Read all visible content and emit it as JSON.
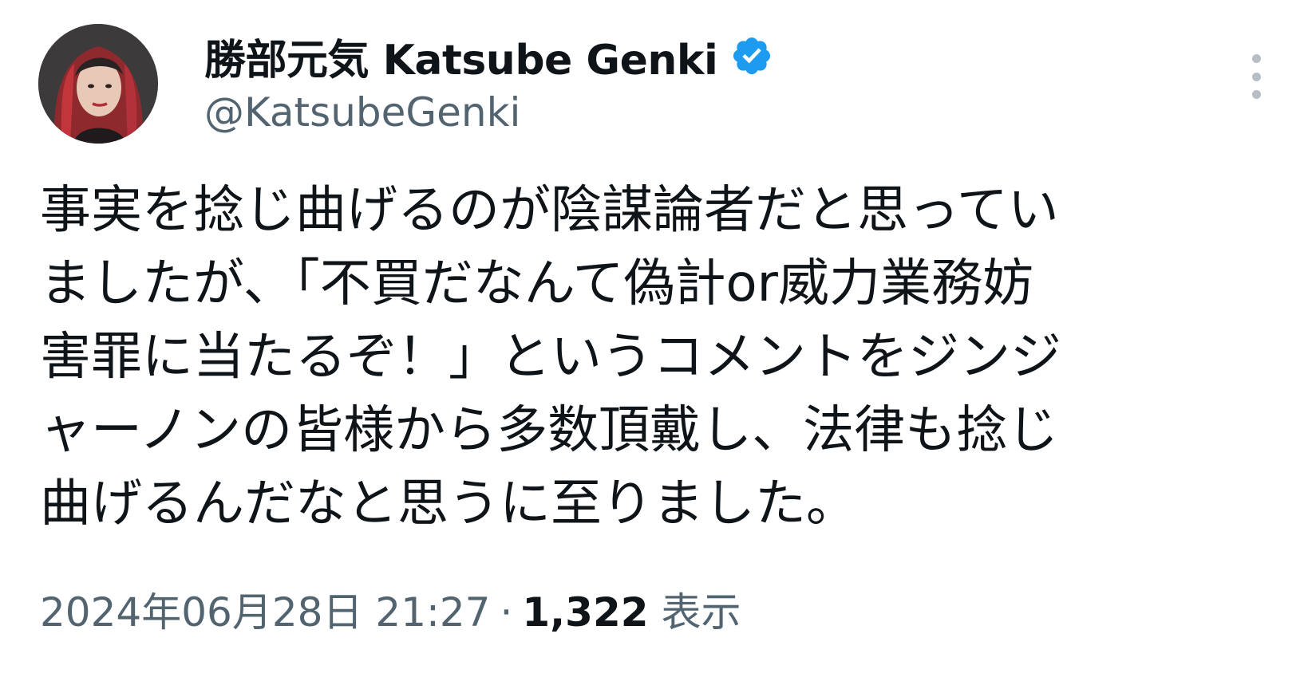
{
  "tweet": {
    "author": {
      "display_name": "勝部元気 Katsube Genki",
      "handle": "@KatsubeGenki",
      "verified": true,
      "avatar_icon": "user-avatar-photo"
    },
    "more_icon": "more-vertical-icon",
    "text_lines": [
      "事実を捻じ曲げるのが陰謀論者だと思ってい",
      "ましたが、「不買だなんて偽計or威力業務妨",
      "害罪に当たるぞ！」というコメントをジンジ",
      "ャーノンの皆様から多数頂戴し、法律も捻じ",
      "曲げるんだなと思うに至りました。"
    ],
    "meta": {
      "timestamp": "2024年06月28日 21:27",
      "separator": "·",
      "views_count": "1,322",
      "views_label": "表示"
    }
  },
  "colors": {
    "text_primary": "#0f1419",
    "text_secondary": "#536471",
    "verified_blue": "#1d9bf0",
    "more_dots": "#b7bec5"
  }
}
